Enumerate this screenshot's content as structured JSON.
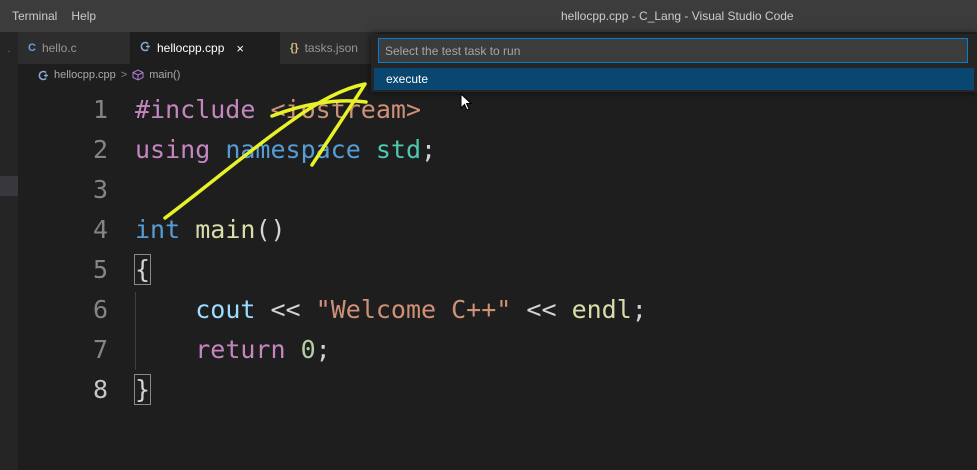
{
  "menu": [
    "Terminal",
    "Help"
  ],
  "window_title": "hellocpp.cpp - C_Lang - Visual Studio Code",
  "tabs": [
    {
      "icon": "C",
      "label": "hello.c"
    },
    {
      "icon": "G",
      "label": "hellocpp.cpp",
      "close": "×"
    },
    {
      "icon": "{}",
      "label": "tasks.json"
    }
  ],
  "breadcrumb": {
    "file": "hellocpp.cpp",
    "separator": ">",
    "symbol": "main()"
  },
  "quick_pick": {
    "placeholder": "Select the test task to run",
    "items": [
      "execute"
    ]
  },
  "editor": {
    "line_numbers": [
      "1",
      "2",
      "3",
      "4",
      "5",
      "6",
      "7",
      "8"
    ],
    "lines": {
      "l1": {
        "directive": "#include",
        "header": "<iostream>"
      },
      "l2": {
        "kw1": "using",
        "kw2": "namespace",
        "name": "std",
        "semi": ";"
      },
      "l4": {
        "type": "int",
        "fn": "main",
        "parens": "()"
      },
      "l5": {
        "brace": "{"
      },
      "l6": {
        "ident": "cout",
        "op1": "<<",
        "str": "\"Welcome C++\"",
        "op2": "<<",
        "endl": "endl",
        "semi": ";"
      },
      "l7": {
        "kw": "return",
        "num": "0",
        "semi": ";"
      },
      "l8": {
        "brace": "}"
      }
    }
  },
  "colors": {
    "annotation": "#e8f227",
    "accent": "#007fd4",
    "selection": "#094771"
  }
}
